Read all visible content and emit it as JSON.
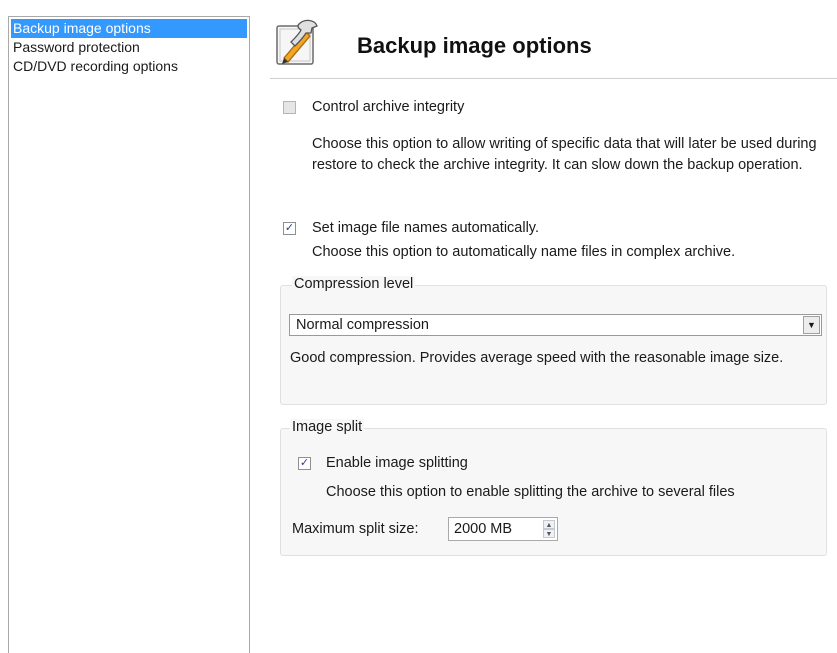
{
  "sidebar": {
    "items": [
      {
        "label": "Backup image options"
      },
      {
        "label": "Password protection"
      },
      {
        "label": "CD/DVD recording options"
      }
    ]
  },
  "header": {
    "title": "Backup image options",
    "icon": "wrench-pencil-icon"
  },
  "options": {
    "control_integrity": {
      "label": "Control archive integrity",
      "checked": false,
      "description": "Choose this option to allow writing of specific data that will later be used during restore to check the archive integrity. It can slow down the backup operation."
    },
    "auto_names": {
      "label": "Set image file names automatically.",
      "checked": true,
      "description": "Choose this option to automatically name files in complex archive."
    }
  },
  "compression": {
    "title": "Compression level",
    "selected": "Normal compression",
    "description": "Good compression. Provides average speed with the reasonable image size."
  },
  "split": {
    "title": "Image split",
    "enable_label": "Enable image splitting",
    "enabled": true,
    "description": "Choose this option to enable splitting the archive to several files",
    "max_size_label": "Maximum split size:",
    "max_size_value": "2000 MB"
  },
  "colors": {
    "selection": "#3399ff",
    "icon_accent": "#f2a626"
  }
}
